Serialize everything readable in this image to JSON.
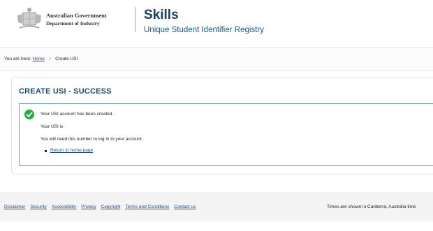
{
  "header": {
    "gov_line1": "Australian Government",
    "gov_line2": "Department of Industry",
    "title": "Skills",
    "subtitle": "Unique Student Identifier Registry"
  },
  "breadcrumb": {
    "prefix": "You are here:",
    "home": "Home",
    "separator": ">",
    "current": "Create USI"
  },
  "main": {
    "heading": "CREATE USI - SUCCESS",
    "messages": [
      "Your USI account has been created.",
      "Your USI is",
      "You will need this number to log in to your account."
    ],
    "return_link": "Return to home page"
  },
  "footer": {
    "links": [
      "Disclaimer",
      "Security",
      "Accessibility",
      "Privacy",
      "Copyright",
      "Terms and Conditions",
      "Contact us"
    ],
    "note": "Times are shown in Canberra, Australia time"
  },
  "colors": {
    "brand_navy": "#1b3e62",
    "link": "#1b4f8a",
    "success": "#22aa44",
    "panel_border": "#6fa9a9"
  },
  "icons": [
    "crest-logo",
    "checkmark-icon"
  ]
}
